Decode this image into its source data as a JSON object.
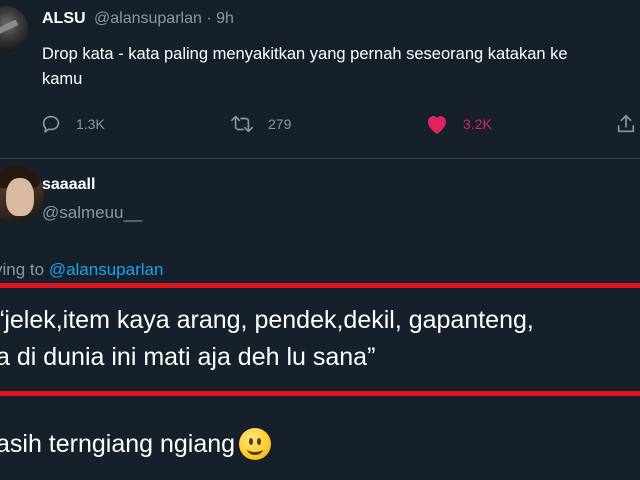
{
  "tweet": {
    "author_name": "ALSU",
    "author_handle": "@alansuparlan · 9h",
    "text_line1": "Drop kata - kata paling menyakitkan yang pernah seseorang katakan ke",
    "text_line2": "kamu",
    "reply_count": "1.3K",
    "retweet_count": "279",
    "like_count": "3.2K",
    "like_color": "#e0245e"
  },
  "reply": {
    "author_name": "saaaall",
    "author_handle": "@salmeuu__",
    "replying_prefix": "ying to ",
    "replying_mention": "@alansuparlan",
    "quote_line1": "“jelek,item kaya arang, pendek,dekil, gapanteng,",
    "quote_line2": "a di dunia ini mati aja deh lu sana”",
    "footer_text": "asih terngiang ngiang",
    "highlight_color": "#e0141e"
  },
  "icons": [
    "avatar",
    "reply-icon",
    "retweet-icon",
    "heart-icon",
    "share-icon",
    "smiling-face-emoji"
  ]
}
